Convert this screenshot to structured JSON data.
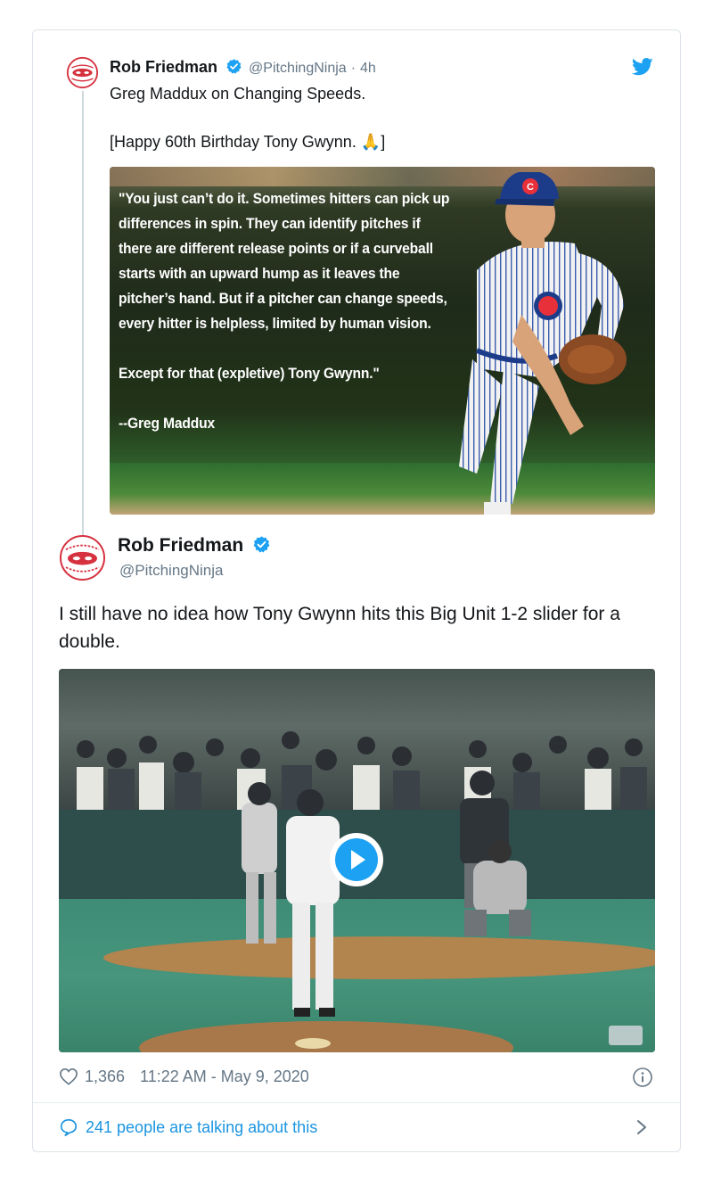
{
  "parent_tweet": {
    "name": "Rob Friedman",
    "handle": "@PitchingNinja",
    "separator": "·",
    "time": "4h",
    "text_line1": "Greg Maddux on Changing Speeds.",
    "text_line2": "[Happy 60th Birthday Tony Gwynn.",
    "text_emoji": "🙏",
    "text_end": "]",
    "quote_image": {
      "paragraph1": "\"You just can’t do it. Sometimes hitters can pick up differences in spin. They can identify pitches if there are different release points or if a curveball starts with an upward hump as it leaves the pitcher’s hand. But if a pitcher can change speeds, every hitter is helpless, limited by human vision.",
      "paragraph2": "Except for that (expletive) Tony Gwynn.\"",
      "attribution": "--Greg Maddux",
      "cap_letter": "C"
    }
  },
  "main_tweet": {
    "name": "Rob Friedman",
    "handle": "@PitchingNinja",
    "text": "I still have no idea how Tony Gwynn hits this Big Unit 1-2 slider for a double.",
    "likes": "1,366",
    "timestamp": "11:22 AM - May 9, 2020",
    "talking": "241 people are talking about this"
  },
  "colors": {
    "twitter_blue": "#1da1f2",
    "link_blue": "#1b95e0",
    "muted": "#657786",
    "avatar_red": "#d6313f"
  },
  "icons": {
    "verified": "verified-badge-icon",
    "bird": "twitter-bird-icon",
    "heart": "heart-icon",
    "info": "info-icon",
    "comment": "comment-bubble-icon",
    "chevron": "chevron-right-icon",
    "play": "play-icon"
  }
}
